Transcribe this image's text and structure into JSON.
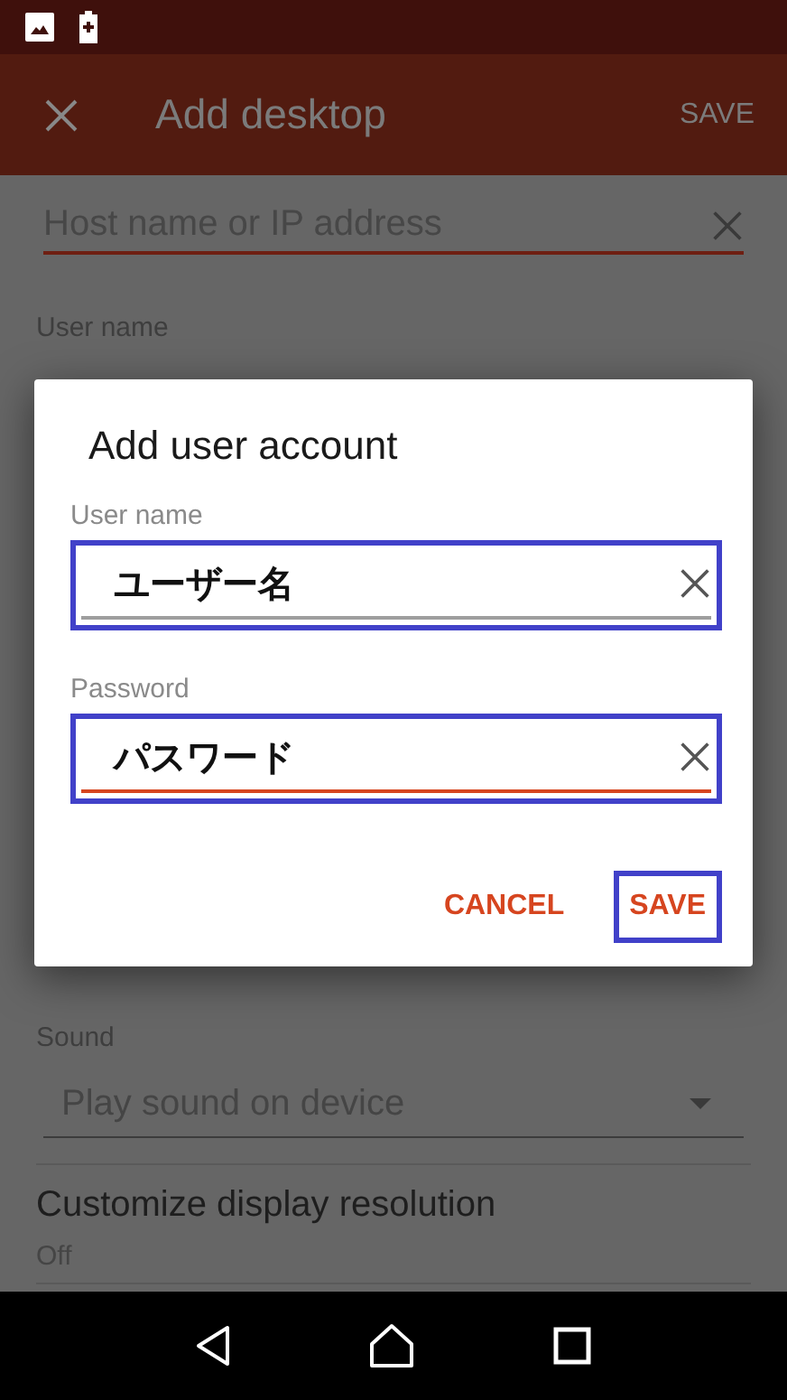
{
  "app_bar": {
    "title": "Add desktop",
    "action": "SAVE"
  },
  "form": {
    "host_field": {
      "placeholder": "Host name or IP address"
    },
    "user_name_label": "User name",
    "sound": {
      "label": "Sound",
      "value": "Play sound on device"
    },
    "display_resolution": {
      "title": "Customize display resolution",
      "value": "Off"
    }
  },
  "dialog": {
    "title": "Add user account",
    "fields": [
      {
        "label": "User name",
        "value": "ユーザー名",
        "focused": false,
        "highlighted": true
      },
      {
        "label": "Password",
        "value": "パスワード",
        "focused": true,
        "highlighted": true
      }
    ],
    "buttons": [
      {
        "label": "CANCEL",
        "highlighted": false
      },
      {
        "label": "SAVE",
        "highlighted": true
      }
    ]
  }
}
